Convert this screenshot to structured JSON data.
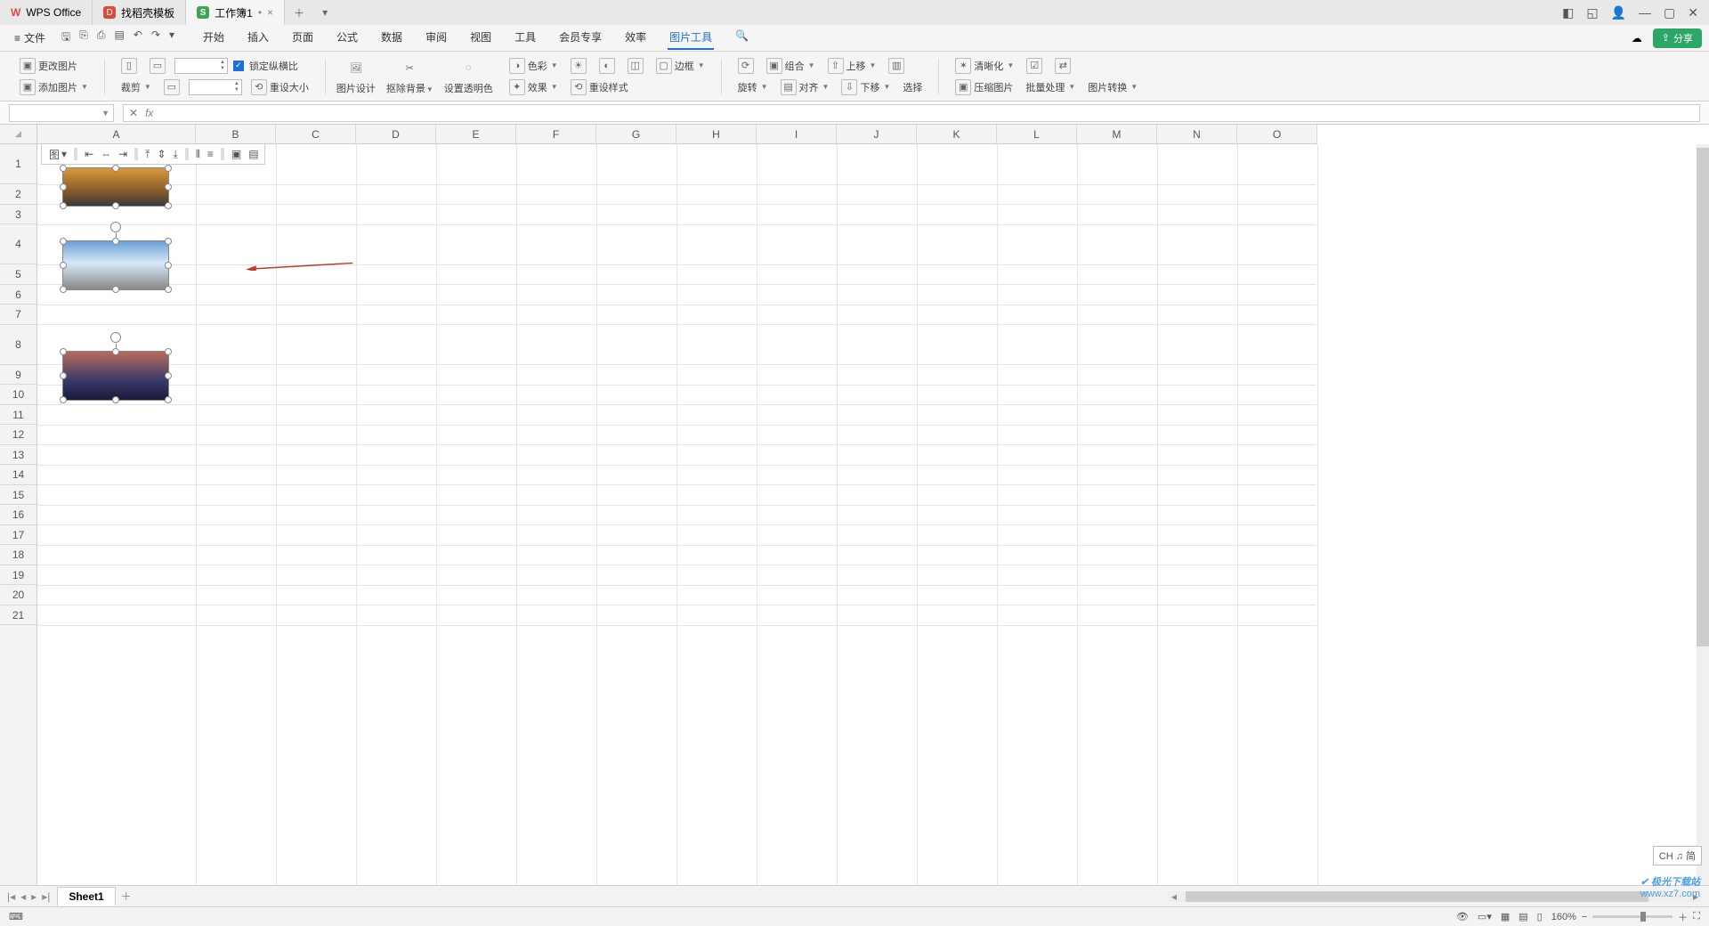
{
  "tabs": {
    "app": "WPS Office",
    "template": "找稻壳模板",
    "doc": "工作簿1"
  },
  "menu": {
    "file": "文件",
    "items": [
      "开始",
      "插入",
      "页面",
      "公式",
      "数据",
      "审阅",
      "视图",
      "工具",
      "会员专享",
      "效率",
      "图片工具"
    ],
    "active": "图片工具",
    "share": "分享"
  },
  "ribbon": {
    "change_img": "更改图片",
    "add_img": "添加图片",
    "crop": "裁剪",
    "lock_ratio": "锁定纵横比",
    "reset_size": "重设大小",
    "pic_design": "图片设计",
    "remove_bg": "抠除背景",
    "set_transparent": "设置透明色",
    "color": "色彩",
    "effect": "效果",
    "border": "边框",
    "reset_style": "重设样式",
    "rotate": "旋转",
    "align": "对齐",
    "group": "组合",
    "move_up": "上移",
    "move_down": "下移",
    "select": "选择",
    "clarity": "清晰化",
    "compress": "压缩图片",
    "batch": "批量处理",
    "img_convert": "图片转换",
    "width_val": "",
    "height_val": ""
  },
  "formula": {
    "name_box": "",
    "fx": "fx"
  },
  "columns": [
    "A",
    "B",
    "C",
    "D",
    "E",
    "F",
    "G",
    "H",
    "I",
    "J",
    "K",
    "L",
    "M",
    "N",
    "O"
  ],
  "rows": [
    "1",
    "2",
    "3",
    "4",
    "5",
    "6",
    "7",
    "8",
    "9",
    "10",
    "11",
    "12",
    "13",
    "14",
    "15",
    "16",
    "17",
    "18",
    "19",
    "20",
    "21"
  ],
  "float_toolbar": {
    "b1": "图",
    "b2": "",
    "b3": "",
    "b4": "",
    "b5": "",
    "b6": "",
    "b7": "",
    "b8": "",
    "b9": "",
    "b10": "",
    "b11": ""
  },
  "sheet": {
    "name": "Sheet1"
  },
  "status": {
    "zoom": "160%"
  },
  "ime": "CH ♫ 简",
  "watermark": {
    "t1": "极光下载站",
    "t2": "www.xz7.com"
  }
}
